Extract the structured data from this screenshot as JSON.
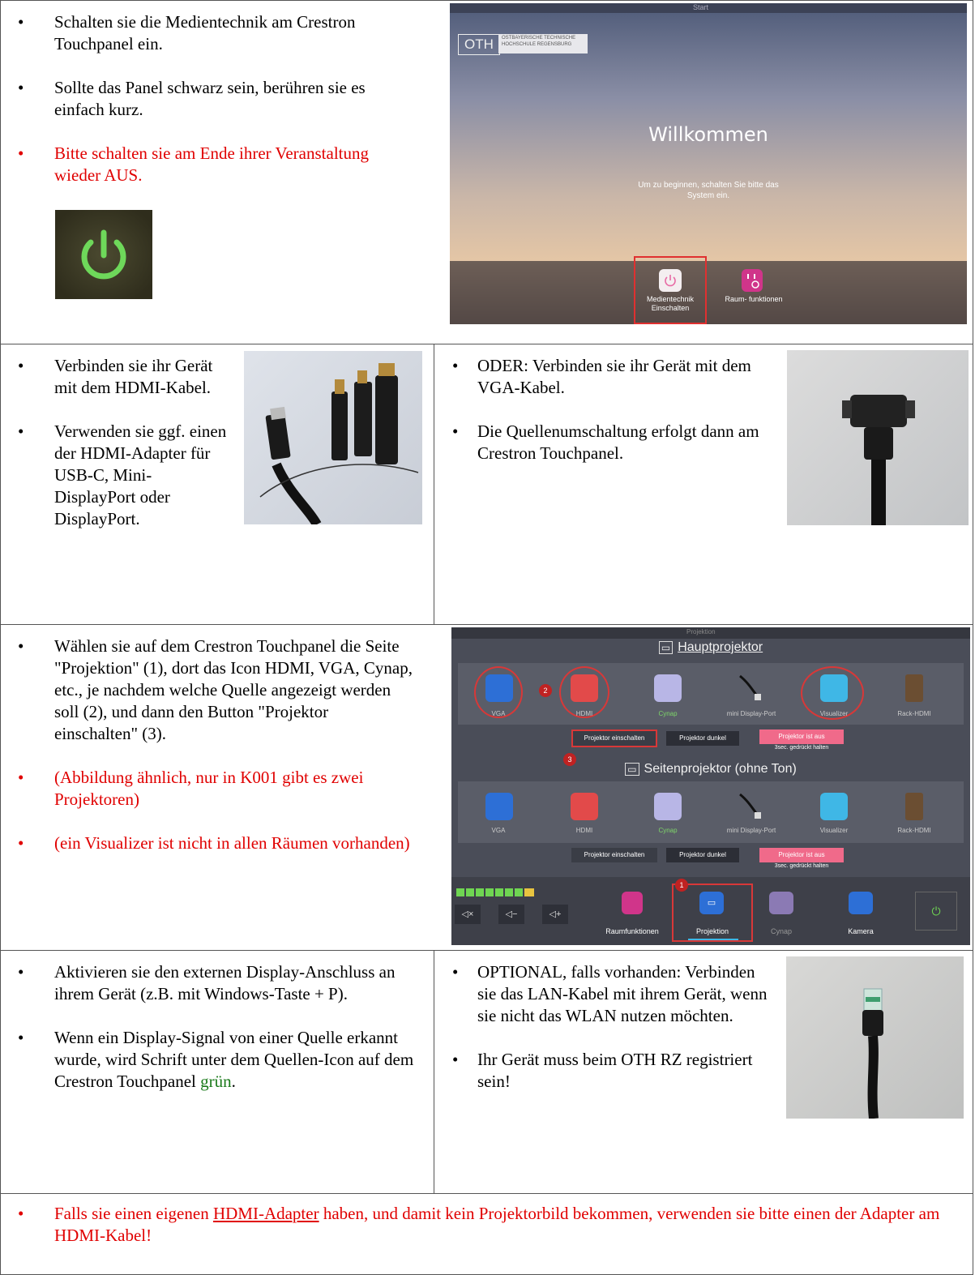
{
  "row1": {
    "items": [
      {
        "text": "Schalten sie die Medientechnik am Crestron Touchpanel ein.",
        "color": "black"
      },
      {
        "text": "Sollte das Panel schwarz sein, berühren sie es einfach kurz.",
        "color": "black"
      },
      {
        "text": "Bitte schalten sie am Ende ihrer Veranstaltung wieder AUS.",
        "color": "red"
      }
    ],
    "panel": {
      "logo": "OTH",
      "logo_sub": "OSTBAYERISCHE TECHNISCHE HOCHSCHULE REGENSBURG",
      "top_label": "Start",
      "welcome": "Willkommen",
      "instruction": "Um zu beginnen, schalten Sie bitte das System ein.",
      "btn_power": "Medientechnik Einschalten",
      "btn_room": "Raum- funktionen"
    }
  },
  "row2": {
    "left_items": [
      {
        "text": "Verbinden sie ihr Gerät mit dem HDMI-Kabel."
      },
      {
        "text": "Verwenden sie ggf. einen der HDMI-Adapter für USB-C, Mini-DisplayPort oder DisplayPort."
      }
    ],
    "right_items": [
      {
        "text": "ODER: Verbinden sie ihr Gerät mit dem VGA-Kabel."
      },
      {
        "text": "Die Quellenumschaltung erfolgt dann am Crestron Touchpanel."
      }
    ]
  },
  "row3": {
    "items": [
      {
        "text": "Wählen sie auf dem Crestron Touchpanel die Seite \"Projektion\" (1), dort das Icon HDMI, VGA, Cynap, etc., je nachdem welche Quelle angezeigt werden soll (2), und dann den Button \"Projektor einschalten\" (3).",
        "color": "black"
      },
      {
        "text": "(Abbildung ähnlich, nur in K001 gibt es zwei Projektoren)",
        "color": "red"
      },
      {
        "text": "(ein Visualizer ist nicht in allen Räumen vorhanden)",
        "color": "red"
      }
    ],
    "panel": {
      "top_label": "Projektion",
      "section1": "Hauptprojektor",
      "section2": "Seitenprojektor (ohne Ton)",
      "sources": [
        "VGA",
        "HDMI",
        "Cynap",
        "mini Display-Port",
        "Visualizer",
        "Rack-HDMI"
      ],
      "btn_on": "Projektor einschalten",
      "btn_dark": "Projektor dunkel",
      "btn_off": "Projektor ist aus",
      "hold_hint": "3sec. gedrückt halten",
      "marker1": "1",
      "marker2": "2",
      "marker3": "3",
      "vol_mute": "◁×",
      "vol_down": "◁−",
      "vol_up": "◁+",
      "nav": [
        "Raumfunktionen",
        "Projektion",
        "Cynap",
        "Kamera"
      ]
    }
  },
  "row4": {
    "left_items": [
      {
        "text": "Aktivieren sie den externen Display-Anschluss an ihrem Gerät (z.B. mit Windows-Taste + P)."
      },
      {
        "pre": "Wenn ein Display-Signal von einer Quelle erkannt wurde, wird Schrift unter dem Quellen-Icon auf dem Crestron Touchpanel ",
        "green": "grün",
        "post": "."
      }
    ],
    "right_items": [
      {
        "text": "OPTIONAL, falls vorhanden: Verbinden sie das LAN-Kabel mit ihrem Gerät, wenn sie nicht das WLAN nutzen möchten."
      },
      {
        "text": "Ihr Gerät muss beim OTH RZ registriert sein!"
      }
    ]
  },
  "row5": {
    "pre": "Falls sie einen eigenen ",
    "link": "HDMI-Adapter",
    "post": " haben, und damit kein Projektorbild bekommen, verwenden sie bitte einen der Adapter am HDMI-Kabel!"
  },
  "colors": {
    "red": "#e00000",
    "green": "#1a7a1a",
    "border": "#555555"
  }
}
